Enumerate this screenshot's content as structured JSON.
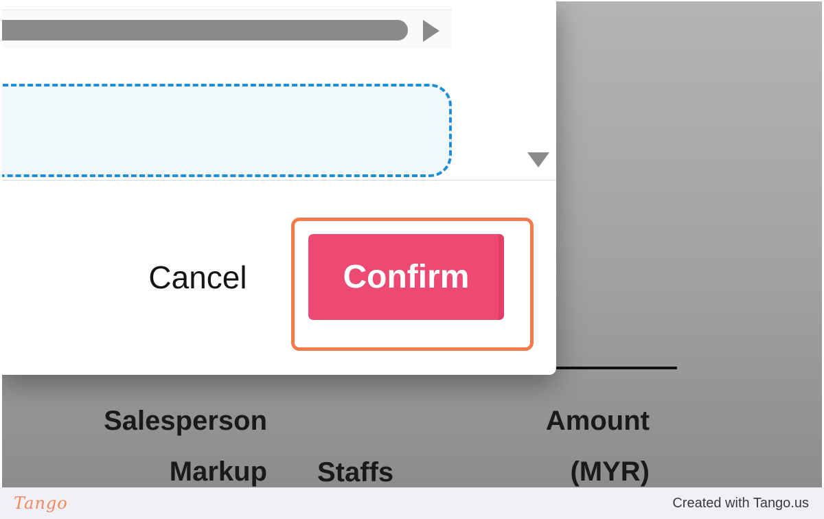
{
  "background_table": {
    "columns": {
      "salesperson_markup": "Salesperson\nMarkup",
      "staffs": "Staffs",
      "amount_myr": "Amount\n(MYR)"
    }
  },
  "modal": {
    "cancel_label": "Cancel",
    "confirm_label": "Confirm"
  },
  "footer": {
    "logo_text": "Tango",
    "credit_text": "Created with Tango.us"
  },
  "colors": {
    "confirm_button": "#ec4a72",
    "highlight_outline": "#f47a4a",
    "drop_zone_border": "#1e8fd6"
  }
}
